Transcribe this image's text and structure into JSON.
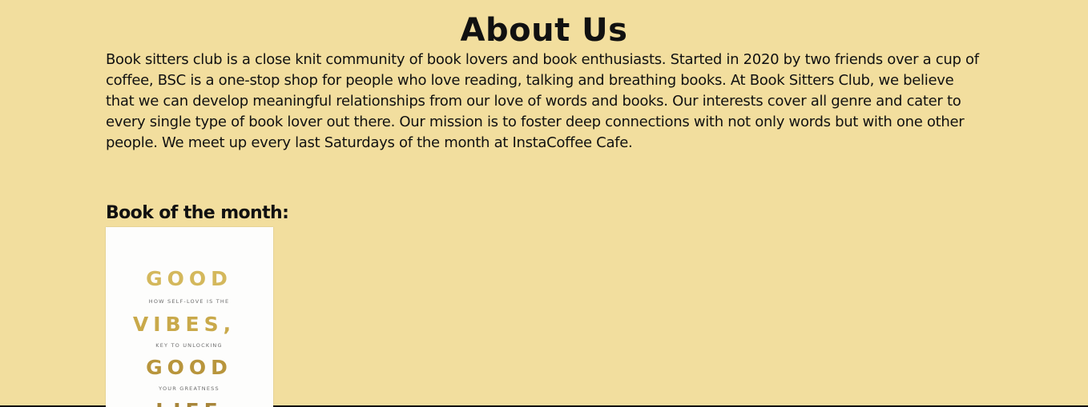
{
  "about": {
    "title": "About Us",
    "paragraph": "Book sitters club is a close knit community of book lovers and book enthusiasts. Started in 2020 by two friends over a cup of coffee, BSC is a one-stop shop for people who love reading, talking and breathing books. At Book Sitters Club, we believe that we can develop meaningful relationships from our love of words and books. Our interests cover all genre and cater to every single type of book lover out there. Our mission is to foster deep connections with not only words but with one other people. We meet up every last Saturdays of the month at InstaCoffee Cafe."
  },
  "book_of_month": {
    "heading": "Book of the month:",
    "cover": {
      "line1": "GOOD",
      "sub1": "HOW SELF-LOVE IS THE",
      "line2": "VIBES,",
      "sub2": "KEY TO UNLOCKING",
      "line3": "GOOD",
      "sub3": "YOUR GREATNESS",
      "line4": "LIFE",
      "gold_color": "#c9a94a"
    }
  }
}
